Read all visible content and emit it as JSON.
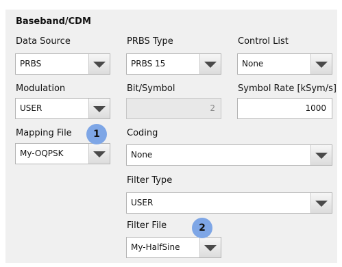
{
  "section_title": "Baseband/CDM",
  "fields": {
    "data_source": {
      "label": "Data Source",
      "value": "PRBS"
    },
    "prbs_type": {
      "label": "PRBS Type",
      "value": "PRBS 15"
    },
    "control_list": {
      "label": "Control List",
      "value": "None"
    },
    "modulation": {
      "label": "Modulation",
      "value": "USER"
    },
    "bit_symbol": {
      "label": "Bit/Symbol",
      "value": "2"
    },
    "symbol_rate": {
      "label": "Symbol Rate [kSym/s]",
      "value": "1000"
    },
    "mapping_file": {
      "label": "Mapping File",
      "value": "My-OQPSK"
    },
    "coding": {
      "label": "Coding",
      "value": "None"
    },
    "filter_type": {
      "label": "Filter Type",
      "value": "USER"
    },
    "filter_file": {
      "label": "Filter File",
      "value": "My-HalfSine"
    }
  },
  "badges": {
    "one": "1",
    "two": "2"
  }
}
